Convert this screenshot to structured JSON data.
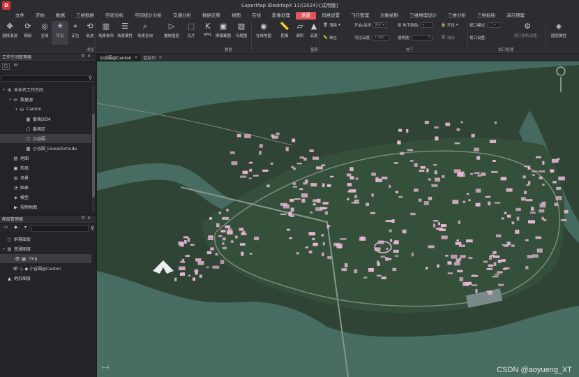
{
  "window": {
    "title": "SuperMap iDesktopX 11i(2024)-[试用版]"
  },
  "menu": [
    "文件",
    "开始",
    "数据",
    "三维数据",
    "空间分析",
    "空间统计分析",
    "交通分析",
    "数据迁移",
    "视图",
    "在线",
    "影像处理",
    "场景",
    "风格设置",
    "飞行管理",
    "对象绘制",
    "三维地理设计",
    "三维分析",
    "三维标绘",
    "演示预案"
  ],
  "menu_active_index": 11,
  "ribbon": {
    "tools": [
      "选择漫游",
      "刷新",
      "全球",
      "可见",
      "定位",
      "轨迹",
      "场景卷帘",
      "场景属性",
      "场景查询",
      "播放图层",
      "瓦片",
      "KML",
      "屏幕截图",
      "专题图",
      "在线地图",
      "距离",
      "面积",
      "高度"
    ],
    "groups": [
      "浏览",
      "数据",
      "量算",
      "地下",
      "视口管理"
    ],
    "labels": {
      "clear": "清除",
      "unit": "单位",
      "open_close": "开启/关闭",
      "close": "关闭",
      "underground_color": "地下颜色:",
      "open": "开设",
      "visible_depth": "可见深度:",
      "depth_value": "1,000",
      "transparency": "透明度:",
      "transparency_value": "0",
      "clear2": "清除",
      "viewport_mode": "视口模式:",
      "viewport_settings": "视口设置:",
      "viewport_setup_btn": "视口相机设置...",
      "layer_props": "图层属性"
    }
  },
  "workspace": {
    "title": "工作空间管理器",
    "tree": [
      {
        "label": "未命名工作空间",
        "icon": "⊞",
        "indent": 0,
        "twisty": "▾"
      },
      {
        "label": "数据源",
        "icon": "⛁",
        "indent": 1,
        "twisty": "▾"
      },
      {
        "label": "Canton",
        "icon": "⛁",
        "indent": 2,
        "twisty": "▾"
      },
      {
        "label": "番禺DEM",
        "icon": "▦",
        "indent": 3,
        "twisty": ""
      },
      {
        "label": "番禺区",
        "icon": "⬠",
        "indent": 3,
        "twisty": ""
      },
      {
        "label": "小谷围",
        "icon": "⬠",
        "indent": 3,
        "twisty": "",
        "selected": true
      },
      {
        "label": "小谷围_LinearExtrude",
        "icon": "▦",
        "indent": 3,
        "twisty": ""
      },
      {
        "label": "地图",
        "icon": "▤",
        "indent": 1,
        "twisty": ""
      },
      {
        "label": "布局",
        "icon": "▣",
        "indent": 1,
        "twisty": ""
      },
      {
        "label": "场景",
        "icon": "◍",
        "indent": 1,
        "twisty": ""
      },
      {
        "label": "图表",
        "icon": "◔",
        "indent": 1,
        "twisty": ""
      },
      {
        "label": "模型",
        "icon": "◈",
        "indent": 1,
        "twisty": ""
      },
      {
        "label": "视频地图",
        "icon": "▶",
        "indent": 1,
        "twisty": ""
      }
    ]
  },
  "layers": {
    "title": "图层管理器",
    "tree": [
      {
        "label": "屏幕图层",
        "icon": "▢",
        "indent": 0,
        "twisty": ""
      },
      {
        "label": "普通图层",
        "icon": "▤",
        "indent": 0,
        "twisty": "▾"
      },
      {
        "label": "img",
        "icon": "👁 ▦",
        "indent": 1,
        "twisty": "",
        "selected": true
      },
      {
        "label": "小谷围@Canton",
        "icon": "👁 ◇ ◆",
        "indent": 1,
        "twisty": ""
      },
      {
        "label": "地形图层",
        "icon": "▲",
        "indent": 0,
        "twisty": ""
      }
    ]
  },
  "map": {
    "tabs": [
      "小谷围@Canton",
      "起始页"
    ],
    "watermark": "CSDN @aoyueng_XT"
  },
  "colors": {
    "accent": "#e0565e",
    "building": "#e9b8d6",
    "water": "#486e63",
    "land": "#2f4434"
  }
}
